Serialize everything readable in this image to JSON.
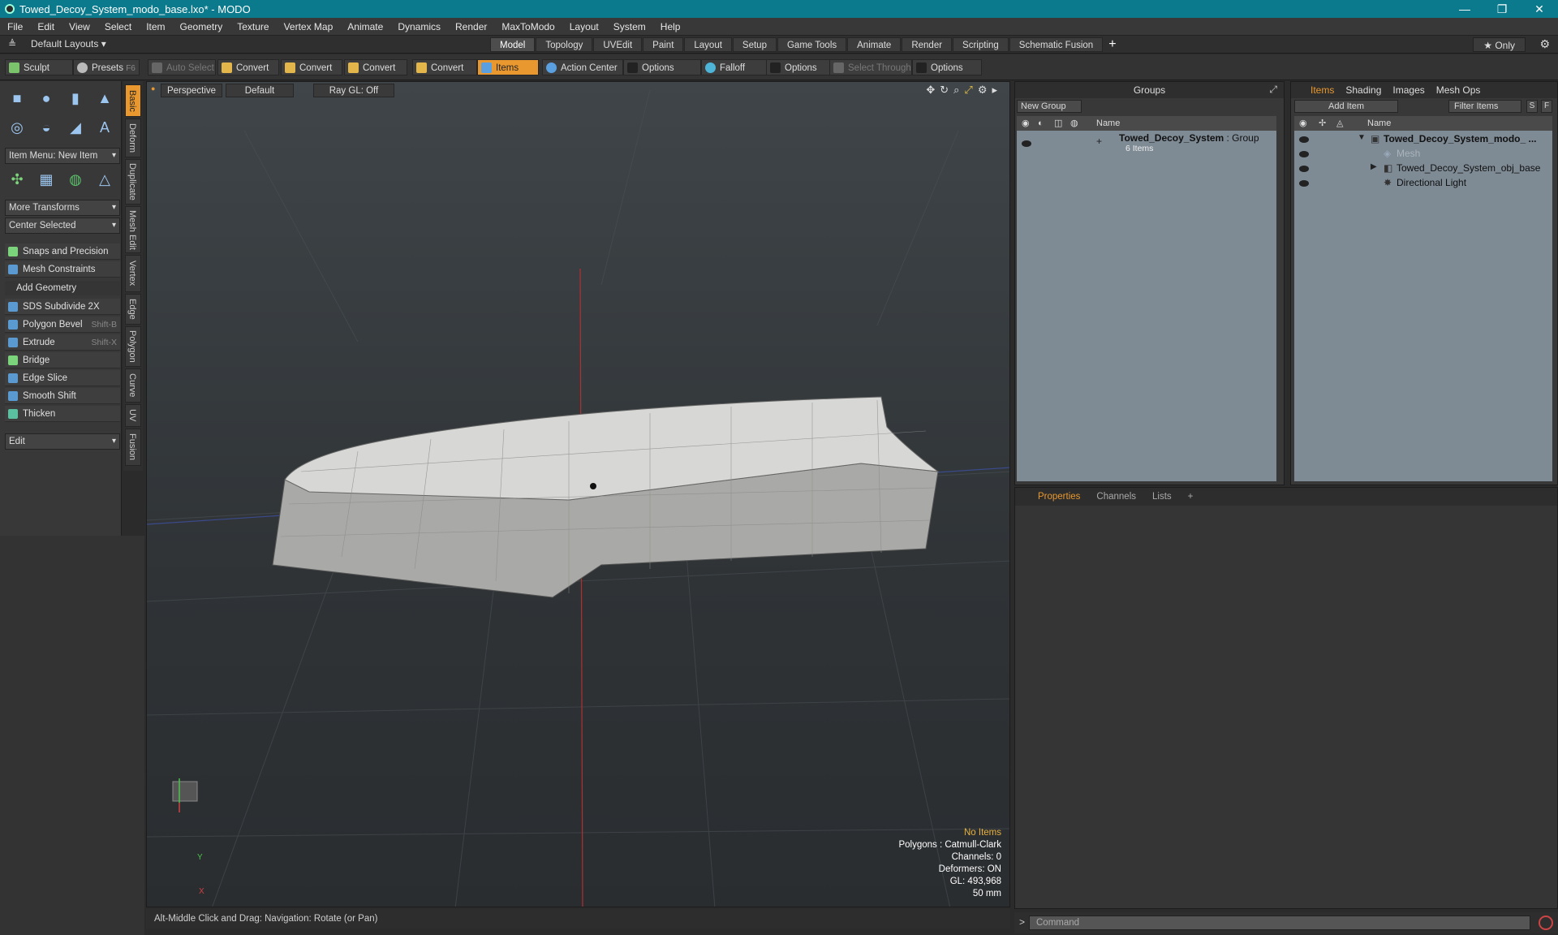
{
  "window": {
    "title": "Towed_Decoy_System_modo_base.lxo* - MODO",
    "minimize": "—",
    "maximize": "❐",
    "close": "✕"
  },
  "menu": [
    "File",
    "Edit",
    "View",
    "Select",
    "Item",
    "Geometry",
    "Texture",
    "Vertex Map",
    "Animate",
    "Dynamics",
    "Render",
    "MaxToModo",
    "Layout",
    "System",
    "Help"
  ],
  "layout": {
    "selector": "Default Layouts ▾",
    "tabs": [
      "Model",
      "Topology",
      "UVEdit",
      "Paint",
      "Layout",
      "Setup",
      "Game Tools",
      "Animate",
      "Render",
      "Scripting",
      "Schematic Fusion"
    ],
    "active_tab": "Model",
    "only": "★  Only"
  },
  "toolbar": {
    "sculpt": "Sculpt",
    "presets": "Presets",
    "presets_key": "F6",
    "auto_select": "Auto Select",
    "convert1": "Convert",
    "convert2": "Convert",
    "convert3": "Convert",
    "convert4": "Convert",
    "items": "Items",
    "action_center": "Action Center",
    "options1": "Options",
    "falloff": "Falloff",
    "options2": "Options",
    "select_through": "Select Through",
    "options3": "Options"
  },
  "left": {
    "item_menu": "Item Menu: New Item",
    "more_transforms": "More Transforms",
    "center_selected": "Center Selected",
    "snaps": "Snaps and Precision",
    "mesh_constraints": "Mesh Constraints",
    "add_geometry": "Add Geometry",
    "tools": [
      {
        "label": "SDS Subdivide 2X",
        "shortcut": ""
      },
      {
        "label": "Polygon Bevel",
        "shortcut": "Shift-B"
      },
      {
        "label": "Extrude",
        "shortcut": "Shift-X"
      },
      {
        "label": "Bridge",
        "shortcut": ""
      },
      {
        "label": "Edge Slice",
        "shortcut": ""
      },
      {
        "label": "Smooth Shift",
        "shortcut": ""
      },
      {
        "label": "Thicken",
        "shortcut": ""
      }
    ],
    "edit": "Edit",
    "vtabs": [
      "Basic",
      "Deform",
      "Duplicate",
      "Mesh Edit",
      "Vertex",
      "Edge",
      "Polygon",
      "Curve",
      "UV",
      "Fusion"
    ]
  },
  "viewport": {
    "view": "Perspective",
    "shading": "Default",
    "raygl": "Ray GL: Off",
    "info": {
      "selection": "No Items",
      "polygons": "Polygons : Catmull-Clark",
      "channels": "Channels: 0",
      "deformers": "Deformers: ON",
      "gl": "GL: 493,968",
      "scale": "50 mm"
    },
    "axis_y": "Y",
    "axis_x": "X"
  },
  "status": "Alt-Middle Click and Drag:   Navigation: Rotate (or Pan)",
  "groups": {
    "title": "Groups",
    "new_group": "New Group",
    "col_name": "Name",
    "group_name": "Towed_Decoy_System",
    "group_type": " : Group",
    "group_count": "6 Items"
  },
  "items": {
    "tabs": [
      "Items",
      "Shading",
      "Images",
      "Mesh Ops"
    ],
    "add_item": "Add Item",
    "filter": "Filter Items",
    "btn_s": "S",
    "btn_f": "F",
    "col_name": "Name",
    "rows": [
      {
        "label": "Towed_Decoy_System_modo_ ..."
      },
      {
        "label": "Mesh"
      },
      {
        "label": "Towed_Decoy_System_obj_base"
      },
      {
        "label": "Directional Light"
      }
    ]
  },
  "props": {
    "tabs": [
      "Properties",
      "Channels",
      "Lists"
    ]
  },
  "command": {
    "placeholder": "Command"
  },
  "colors": {
    "titlebar": "#0b7a8c",
    "accent": "#e8982f",
    "list_bg": "#7e8a94"
  }
}
